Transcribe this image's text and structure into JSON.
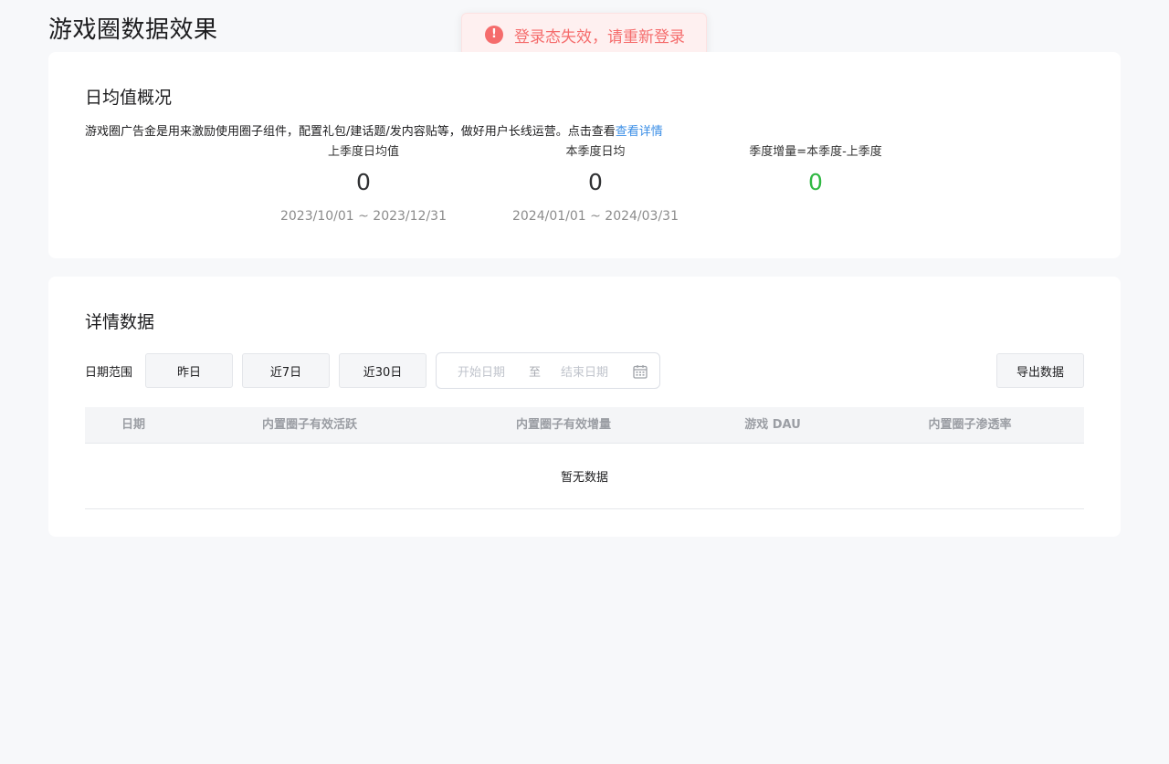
{
  "page": {
    "title": "游戏圈数据效果"
  },
  "toast": {
    "icon": "!",
    "message": "登录态失效，请重新登录"
  },
  "overview": {
    "title": "日均值概况",
    "description": "游戏圈广告金是用来激励使用圈子组件，配置礼包/建话题/发内容贴等，做好用户长线运营。点击查看",
    "link_text": "查看详情",
    "stats": [
      {
        "label": "上季度日均值",
        "value": "0",
        "range": "2023/10/01 ~ 2023/12/31"
      },
      {
        "label": "本季度日均",
        "value": "0",
        "range": "2024/01/01 ~ 2024/03/31"
      },
      {
        "label": "季度增量=本季度-上季度",
        "value": "0"
      }
    ],
    "colors": {
      "increment": "#30b843",
      "link": "#3a8ee6"
    }
  },
  "detail": {
    "title": "详情数据",
    "filter_label": "日期范围",
    "buttons": {
      "yesterday": "昨日",
      "last7": "近7日",
      "last30": "近30日",
      "export": "导出数据"
    },
    "date_range": {
      "start_placeholder": "开始日期",
      "separator": "至",
      "end_placeholder": "结束日期",
      "icon": "calendar-icon"
    },
    "table": {
      "columns": [
        "日期",
        "内置圈子有效活跃",
        "内置圈子有效增量",
        "游戏 DAU",
        "内置圈子渗透率"
      ],
      "empty_text": "暂无数据"
    }
  }
}
